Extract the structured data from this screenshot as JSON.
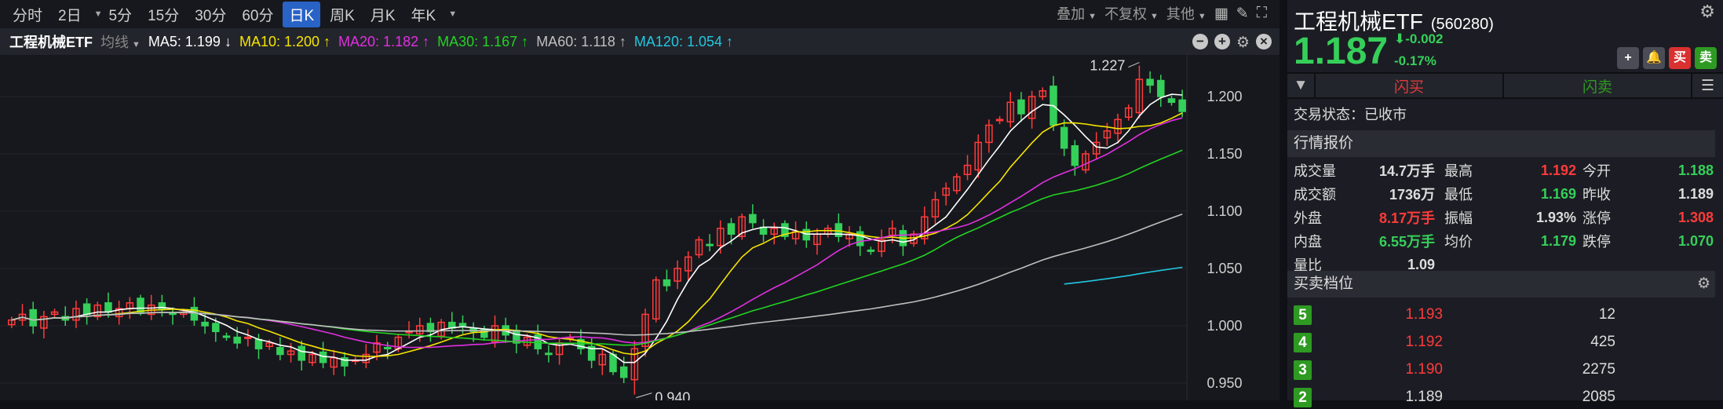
{
  "toolbar": {
    "periods": [
      "分时",
      "2日",
      "5分",
      "15分",
      "30分",
      "60分",
      "日K",
      "周K",
      "月K",
      "年K"
    ],
    "active": "日K",
    "right": [
      "叠加",
      "不复权",
      "其他"
    ]
  },
  "legend": {
    "name": "工程机械ETF",
    "ma_label": "均线",
    "mas": [
      {
        "text": "MA5: 1.199 ↓",
        "color": "#ffffff"
      },
      {
        "text": "MA10: 1.200 ↑",
        "color": "#f5e400"
      },
      {
        "text": "MA20: 1.182 ↑",
        "color": "#e030e0"
      },
      {
        "text": "MA30: 1.167 ↑",
        "color": "#22d322"
      },
      {
        "text": "MA60: 1.118 ↑",
        "color": "#bfbfbf"
      },
      {
        "text": "MA120: 1.054 ↑",
        "color": "#22c8e0"
      }
    ]
  },
  "chart_data": {
    "type": "candlestick",
    "ylim": [
      0.93,
      1.235
    ],
    "yticks": [
      "1.200",
      "1.150",
      "1.100",
      "1.050",
      "1.000",
      "0.950"
    ],
    "ytick_values": [
      1.2,
      1.15,
      1.1,
      1.05,
      1.0,
      0.95
    ],
    "high_label": "1.227",
    "low_label": "0.940",
    "up_color": "#ff3b3b",
    "down_color": "#35d05a",
    "closes": [
      1.005,
      1.01,
      1.0,
      1.008,
      1.012,
      1.005,
      1.015,
      1.01,
      1.018,
      1.012,
      1.015,
      1.02,
      1.012,
      1.018,
      1.015,
      1.01,
      1.012,
      1.005,
      1.0,
      0.995,
      0.99,
      0.985,
      0.99,
      0.98,
      0.985,
      0.975,
      0.978,
      0.97,
      0.975,
      0.968,
      0.972,
      0.965,
      0.97,
      0.975,
      0.985,
      0.98,
      0.99,
      0.995,
      1.0,
      0.995,
      1.003,
      0.998,
      1.0,
      0.995,
      0.99,
      1.0,
      0.992,
      0.985,
      0.99,
      0.98,
      0.975,
      0.985,
      0.99,
      0.98,
      0.97,
      0.975,
      0.96,
      0.955,
      0.98,
      1.01,
      1.04,
      1.035,
      1.05,
      1.06,
      1.075,
      1.07,
      1.085,
      1.08,
      1.095,
      1.09,
      1.08,
      1.085,
      1.078,
      1.082,
      1.075,
      1.08,
      1.085,
      1.078,
      1.08,
      1.07,
      1.065,
      1.075,
      1.085,
      1.07,
      1.08,
      1.095,
      1.11,
      1.12,
      1.13,
      1.14,
      1.16,
      1.175,
      1.18,
      1.195,
      1.185,
      1.2,
      1.205,
      1.175,
      1.155,
      1.14,
      1.15,
      1.16,
      1.17,
      1.18,
      1.19,
      1.215,
      1.21,
      1.2,
      1.195,
      1.187
    ]
  },
  "quote": {
    "name": "工程机械ETF",
    "code": "(560280)",
    "price": "1.187",
    "change": "-0.002",
    "pct": "-0.17%",
    "buttons": [
      "+",
      "🔔",
      "买",
      "卖"
    ],
    "flash_buy": "闪买",
    "flash_sell": "闪卖",
    "status": "交易状态：已收市",
    "section": "行情报价",
    "stats": [
      [
        "成交量",
        "14.7万手",
        "最高",
        "1.192",
        "今开",
        "1.188"
      ],
      [
        "成交额",
        "1736万",
        "最低",
        "1.169",
        "昨收",
        "1.189"
      ],
      [
        "外盘",
        "8.17万手",
        "振幅",
        "1.93%",
        "涨停",
        "1.308"
      ],
      [
        "内盘",
        "6.55万手",
        "均价",
        "1.179",
        "跌停",
        "1.070"
      ],
      [
        "量比",
        "1.09",
        "",
        "",
        "",
        ""
      ]
    ],
    "stat_colors": [
      [
        "#ddd",
        "#ff3b3b",
        "#35d05a"
      ],
      [
        "#ddd",
        "#35d05a",
        "#ddd"
      ],
      [
        "#ff3b3b",
        "#ddd",
        "#ff3b3b"
      ],
      [
        "#35d05a",
        "#35d05a",
        "#35d05a"
      ],
      [
        "#ddd",
        "#ddd",
        "#ddd"
      ]
    ],
    "orders_title": "买卖档位",
    "orders": [
      {
        "level": "5",
        "price": "1.193",
        "qty": "12",
        "color": "#ff3b3b"
      },
      {
        "level": "4",
        "price": "1.192",
        "qty": "425",
        "color": "#ff3b3b"
      },
      {
        "level": "3",
        "price": "1.190",
        "qty": "2275",
        "color": "#ff3b3b"
      },
      {
        "level": "2",
        "price": "1.189",
        "qty": "2085",
        "color": "#dddddd"
      }
    ]
  }
}
